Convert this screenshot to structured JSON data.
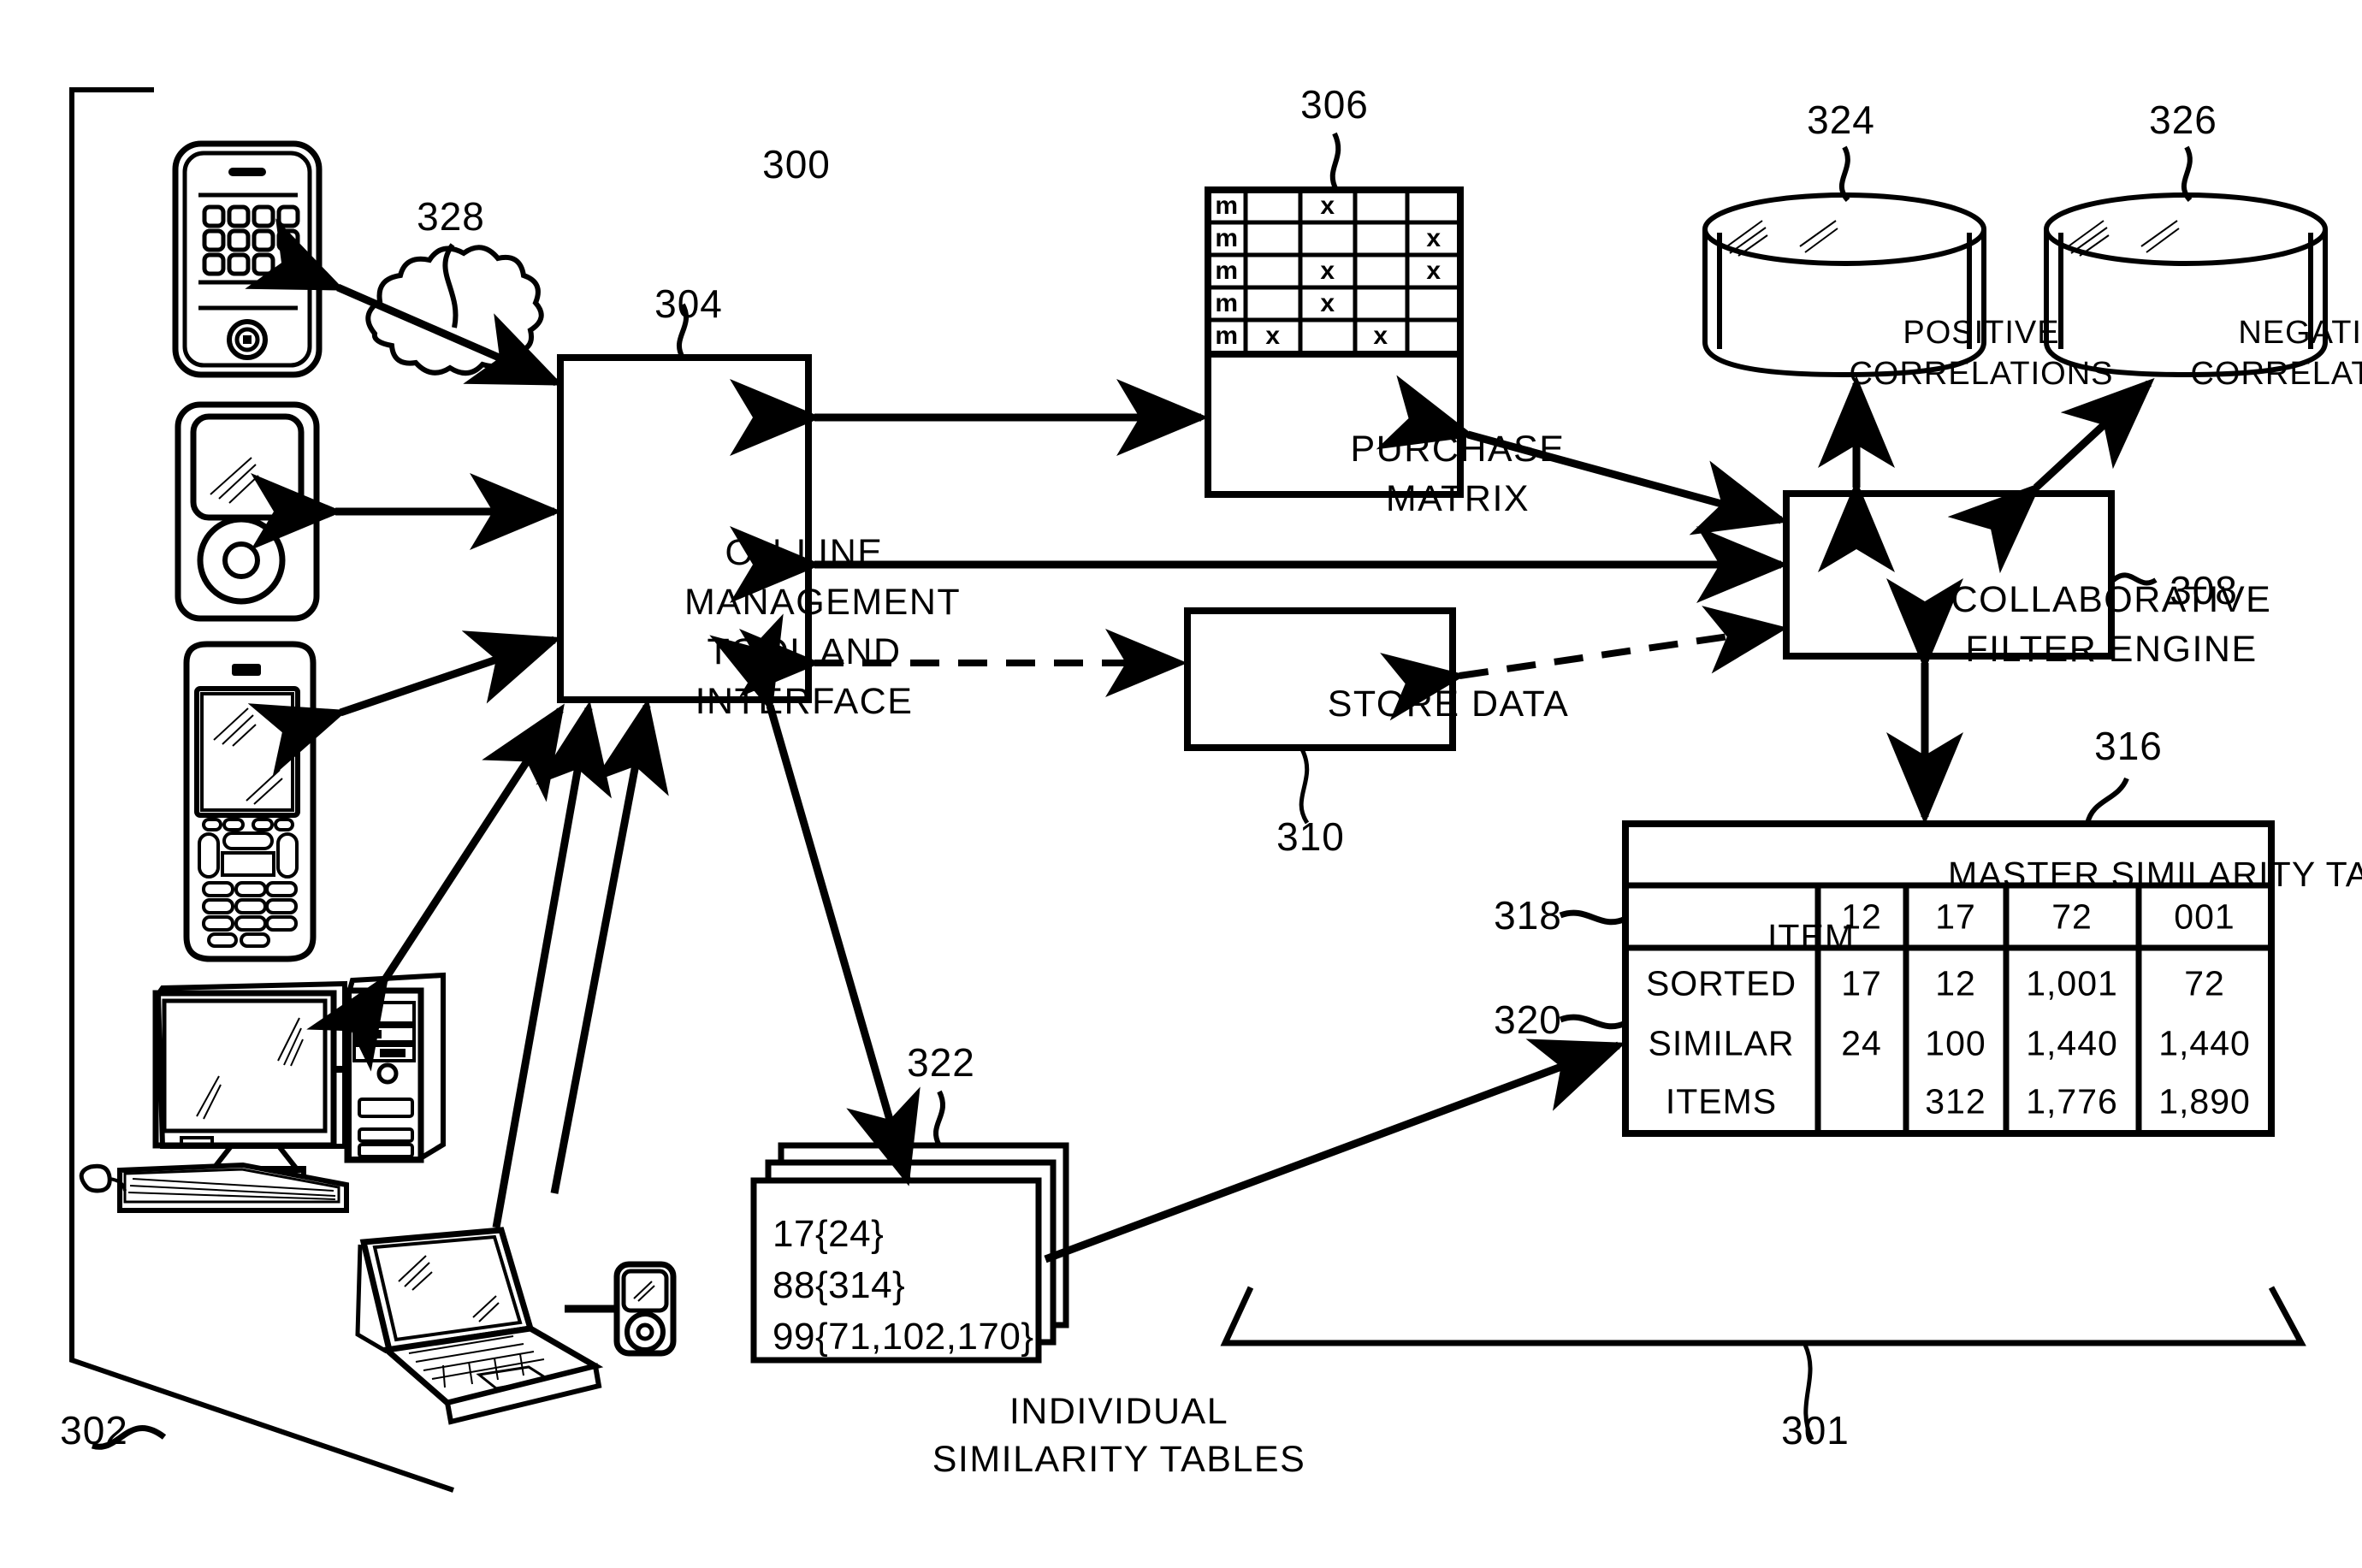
{
  "figure": {
    "reference_numerals": {
      "system": "300",
      "network_bracket": "301",
      "devices_bracket": "302",
      "management_tool": "304",
      "purchase_matrix": "306",
      "filter_engine": "308",
      "store_data": "310",
      "master_table": "316",
      "item_row": "318",
      "sorted_items_row": "320",
      "individual_tables": "322",
      "positive_db": "324",
      "negative_db": "326",
      "cloud": "328"
    }
  },
  "nodes": {
    "management_tool": {
      "line1": "ON-LINE",
      "line2": "MANAGEMENT",
      "line3": "TOOL AND",
      "line4": "INTERFACE"
    },
    "purchase_matrix": {
      "line1": "PURCHASE",
      "line2": "MATRIX"
    },
    "store_data": {
      "label": "STORE DATA"
    },
    "filter_engine": {
      "line1": "COLLABORATIVE",
      "line2": "FILTER ENGINE"
    },
    "positive_correlations": {
      "line1": "POSITIVE",
      "line2": "CORRELATIONS"
    },
    "negative_correlations": {
      "line1": "NEGATIVE",
      "line2": "CORRELATIONS"
    },
    "individual_similarity_tables": {
      "rows": [
        "17{24}",
        "88{314}",
        "99{71,102,170}"
      ],
      "caption_line1": "INDIVIDUAL",
      "caption_line2": "SIMILARITY TABLES"
    }
  },
  "purchase_matrix_grid": {
    "row_label": "m",
    "mark": "x",
    "rows": [
      [
        false,
        true,
        false,
        false
      ],
      [
        false,
        false,
        false,
        true
      ],
      [
        false,
        true,
        false,
        true
      ],
      [
        false,
        true,
        false,
        false
      ],
      [
        true,
        false,
        true,
        false
      ]
    ]
  },
  "master_similarity_table": {
    "title": "MASTER SIMILARITY TABLE OF ITEMS",
    "item_row_label": "ITEM",
    "sorted_label_lines": [
      "SORTED",
      "SIMILAR",
      "ITEMS"
    ],
    "items": [
      "12",
      "17",
      "72",
      "001"
    ],
    "sorted_similar_items": [
      [
        "17",
        "24",
        ""
      ],
      [
        "12",
        "100",
        "312"
      ],
      [
        "1,001",
        "1,440",
        "1,776"
      ],
      [
        "72",
        "1,440",
        "1,890"
      ]
    ]
  },
  "devices": [
    {
      "name": "smartphone"
    },
    {
      "name": "media-player"
    },
    {
      "name": "feature-phone"
    },
    {
      "name": "desktop-computer"
    },
    {
      "name": "laptop-computer"
    },
    {
      "name": "portable-media-player"
    }
  ],
  "icons": {
    "cloud": "cloud-icon",
    "smartphone": "smartphone-icon",
    "media_player": "media-player-icon",
    "feature_phone": "feature-phone-icon",
    "desktop": "desktop-computer-icon",
    "laptop": "laptop-icon",
    "small_player": "portable-media-player-icon",
    "positive_db": "database-cylinder-icon",
    "negative_db": "database-cylinder-icon"
  },
  "colors": {
    "ink": "#000000",
    "paper": "#ffffff"
  }
}
